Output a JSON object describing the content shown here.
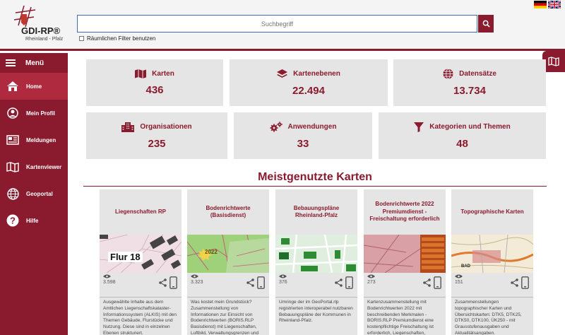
{
  "header": {
    "logo": {
      "title": "GDI-RP®",
      "subtitle": "Rheinland - Pfalz"
    },
    "search": {
      "placeholder": "Suchbegriff"
    },
    "filter_label": "Räumlichen Filter benutzen",
    "flags": [
      "german-flag-icon",
      "english-flag-icon"
    ]
  },
  "sidebar": {
    "menu_label": "Menü",
    "items": [
      {
        "label": "Home",
        "icon": "home-icon"
      },
      {
        "label": "Mein Profil",
        "icon": "user-icon"
      },
      {
        "label": "Meldungen",
        "icon": "newspaper-icon"
      },
      {
        "label": "Kartenviewer",
        "icon": "map-icon"
      },
      {
        "label": "Geoportal",
        "icon": "globe-icon"
      },
      {
        "label": "Hilfe",
        "icon": "question-icon"
      }
    ]
  },
  "stats": [
    {
      "label": "Karten",
      "value": "436",
      "icon": "map-icon"
    },
    {
      "label": "Kartenebenen",
      "value": "22.494",
      "icon": "layers-icon"
    },
    {
      "label": "Datensätze",
      "value": "13.734",
      "icon": "globe-icon"
    },
    {
      "label": "Organisationen",
      "value": "235",
      "icon": "building-icon"
    },
    {
      "label": "Anwendungen",
      "value": "33",
      "icon": "gears-icon"
    },
    {
      "label": "Kategorien und Themen",
      "value": "48",
      "icon": "filter-icon"
    }
  ],
  "section_title": "Meistgenutzte Karten",
  "cards": [
    {
      "title": "Liegenschaften RP",
      "views": "3.598",
      "image_label": "Flur 18",
      "description": "Ausgewählte Inhalte aus dem Amtlichen Liegenschaftskataster-Informationssystem (ALKIS) mit den Themen Gebäude, Flurstücke und Nutzung. Diese sind in einzelnen Ebenen strukturiert."
    },
    {
      "title": "Bodenrichtwerte (Basisdienst)",
      "views": "3.323",
      "image_label": "2022",
      "description": "Was kostet mein Grundstück? Zusammenstellung von Informationen zur Einsicht von Bodenrichtwerten (BORIS.RLP Basisdienst) mit Liegenschaften, Luftbild, Verwaltungsgrenzen und Geografie."
    },
    {
      "title": "Bebauungspläne Rheinland-Pfalz",
      "views": "376",
      "image_label": "",
      "description": "Umringe der im GeoPortal.rlp registrierten interoperabel nutzbaren Bebauungspläne der Kommunen in Rheinland-Pfalz."
    },
    {
      "title": "Bodenrichtwerte 2022 Premiumdienst - Freischaltung erforderlich",
      "views": "273",
      "image_label": "",
      "description": "Kartenzusammenstellung mit Bodenrichtwerten 2022 mit beschreibenden Merkmalen - BORIS.RLP Premiumdienst eine kostenpflichtige Freischaltung ist erforderlich, Liegenschaften, Luftbild, Verwaltungsgrenzen."
    },
    {
      "title": "Topographische Karten",
      "views": "151",
      "image_label": "BAD",
      "description": "Zusammenstellungen topographischer Karten und Übersichtskarten: DTK5, DTK25, DTK50, DTK100, ÜK250 - mit Grausstufenausgaben und Aktualitätsangaben."
    }
  ],
  "colors": {
    "brand": "#8a1b2e",
    "brand_light": "#b02a3f",
    "tile_bg": "#e5e5e5"
  }
}
